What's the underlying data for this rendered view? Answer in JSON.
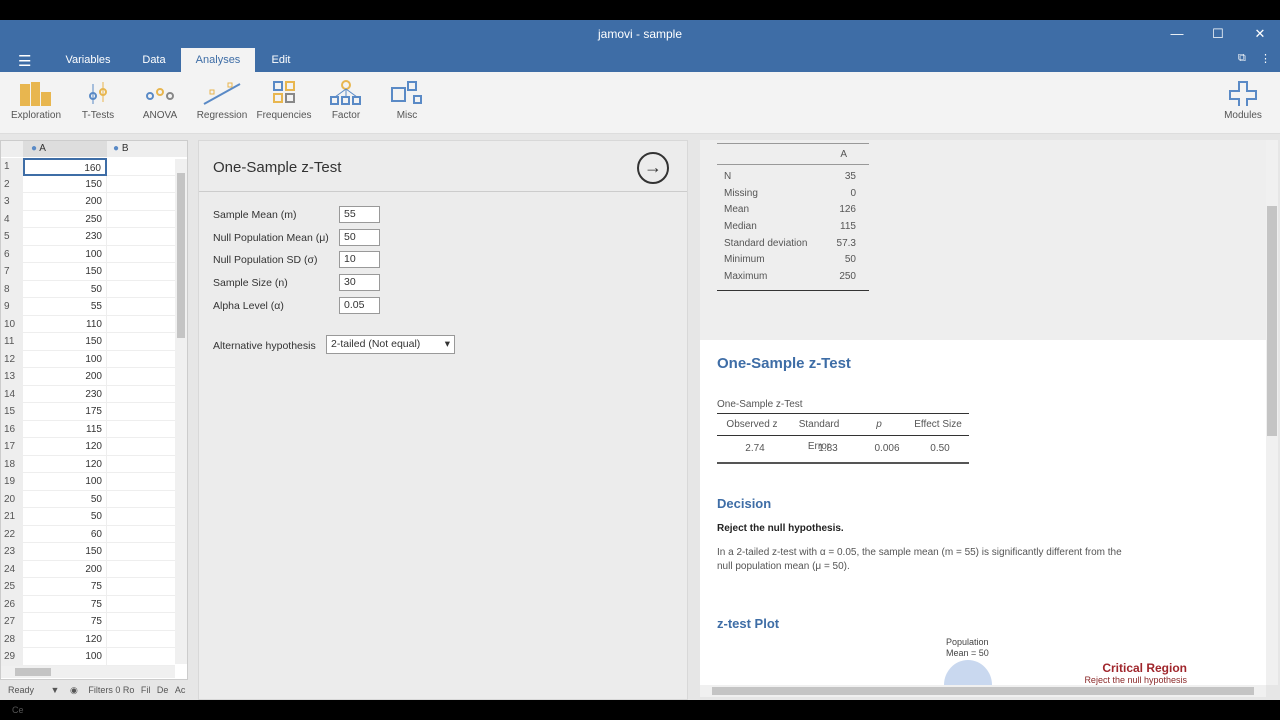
{
  "window": {
    "title": "jamovi - sample"
  },
  "tabs": [
    {
      "label": "Variables"
    },
    {
      "label": "Data"
    },
    {
      "label": "Analyses"
    },
    {
      "label": "Edit"
    }
  ],
  "ribbon": [
    {
      "label": "Exploration",
      "icon": "bar-chart-icon"
    },
    {
      "label": "T-Tests",
      "icon": "t-test-icon"
    },
    {
      "label": "ANOVA",
      "icon": "anova-icon"
    },
    {
      "label": "Regression",
      "icon": "regression-icon"
    },
    {
      "label": "Frequencies",
      "icon": "frequencies-icon"
    },
    {
      "label": "Factor",
      "icon": "factor-icon"
    },
    {
      "label": "Misc",
      "icon": "misc-icon"
    }
  ],
  "modules_label": "Modules",
  "grid": {
    "columns": [
      "A",
      "B"
    ],
    "rows": [
      "1",
      "2",
      "3",
      "4",
      "5",
      "6",
      "7",
      "8",
      "9",
      "10",
      "11",
      "12",
      "13",
      "14",
      "15",
      "16",
      "17",
      "18",
      "19",
      "20",
      "21",
      "22",
      "23",
      "24",
      "25",
      "26",
      "27",
      "28",
      "29"
    ],
    "values": [
      "160",
      "150",
      "200",
      "250",
      "230",
      "100",
      "150",
      "50",
      "55",
      "110",
      "150",
      "100",
      "200",
      "230",
      "175",
      "115",
      "120",
      "120",
      "100",
      "50",
      "50",
      "60",
      "150",
      "200",
      "75",
      "75",
      "75",
      "120",
      "100"
    ]
  },
  "status": {
    "ready": "Ready",
    "filters": "Filters 0 Ro",
    "f1": "Fil",
    "f2": "De",
    "f3": "Ac",
    "f4": "Ce"
  },
  "options": {
    "title": "One-Sample z-Test",
    "fields": [
      {
        "label": "Sample Mean (m)",
        "value": "55"
      },
      {
        "label": "Null Population Mean (μ)",
        "value": "50"
      },
      {
        "label": "Null Population SD (σ)",
        "value": "10"
      },
      {
        "label": "Sample Size (n)",
        "value": "30"
      },
      {
        "label": "Alpha Level (α)",
        "value": "0.05"
      }
    ],
    "alt_label": "Alternative hypothesis",
    "alt_value": "2-tailed (Not equal)"
  },
  "descriptives": {
    "col": "A",
    "rows": [
      [
        "N",
        "35"
      ],
      [
        "Missing",
        "0"
      ],
      [
        "Mean",
        "126"
      ],
      [
        "Median",
        "115"
      ],
      [
        "Standard deviation",
        "57.3"
      ],
      [
        "Minimum",
        "50"
      ],
      [
        "Maximum",
        "250"
      ]
    ]
  },
  "ztest": {
    "title": "One-Sample z-Test",
    "table_title": "One-Sample z-Test",
    "headers": [
      "Observed z",
      "Standard Error",
      "p",
      "Effect Size"
    ],
    "values": [
      "2.74",
      "1.83",
      "0.006",
      "0.50"
    ]
  },
  "decision": {
    "title": "Decision",
    "headline": "Reject the null hypothesis.",
    "text1": "In a 2-tailed z-test with α = 0.05, the sample mean (m = 55) is significantly different from the",
    "text2": "null population mean (μ = 50)."
  },
  "plot": {
    "title": "z-test Plot",
    "pop_label1": "Population",
    "pop_label2": "Mean = 50",
    "crit_title": "Critical Region",
    "crit_sub": "Reject the null hypothesis"
  }
}
